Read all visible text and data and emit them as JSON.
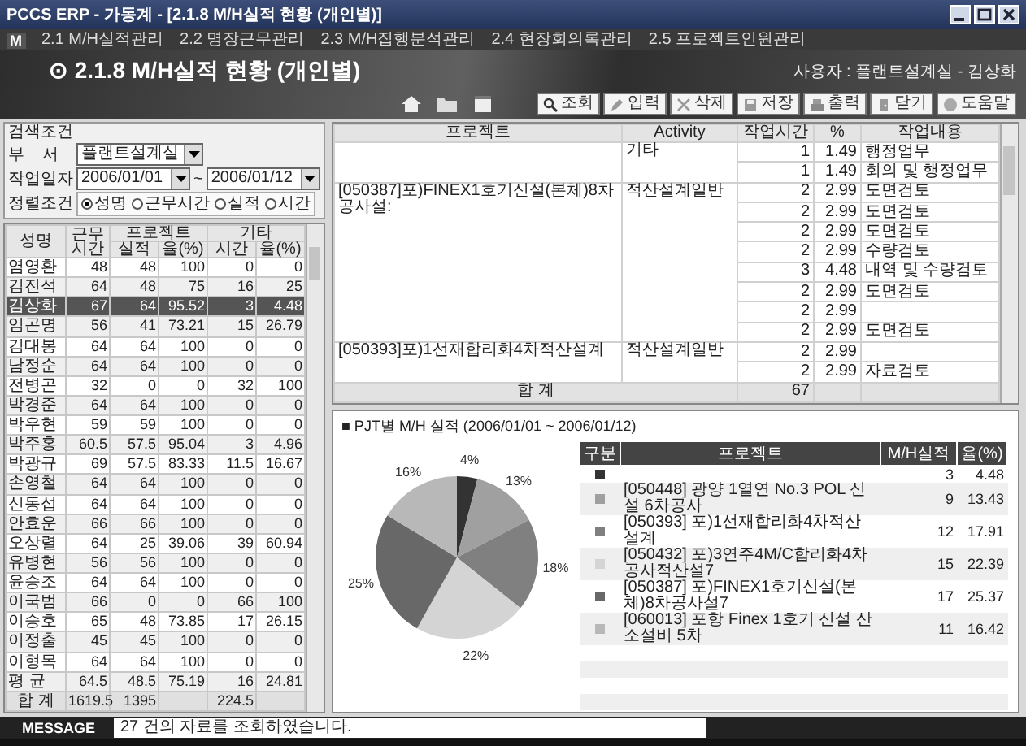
{
  "window": {
    "title": "PCCS ERP - 가동계 - [2.1.8 M/H실적 현황 (개인별)]"
  },
  "menu": {
    "logo": "M",
    "items": [
      "2.1 M/H실적관리",
      "2.2 명장근무관리",
      "2.3 M/H집행분석관리",
      "2.4 현장회의록관리",
      "2.5 프로젝트인원관리"
    ]
  },
  "header": {
    "title": "⊙ 2.1.8 M/H실적 현황 (개인별)",
    "user": "사용자 : 플랜트설계실 - 김상화"
  },
  "toolbar": [
    "조회",
    "입력",
    "삭제",
    "저장",
    "출력",
    "닫기",
    "도움말"
  ],
  "search": {
    "title": "검색조건",
    "dept_label": "부    서",
    "dept": "플랜트설계실",
    "date_label": "작업일자",
    "date_from": "2006/01/01",
    "tilde": "~",
    "date_to": "2006/01/12",
    "sort_label": "정렬조건",
    "sort_options": [
      {
        "label": "성명",
        "selected": true
      },
      {
        "label": "근무시간",
        "selected": false
      },
      {
        "label": "실적",
        "selected": false
      },
      {
        "label": "시간",
        "selected": false
      }
    ]
  },
  "grid": {
    "columns": {
      "name": "성명",
      "hours": "근무시간",
      "project": "프로젝트",
      "other": "기타",
      "actual": "실적",
      "ratio": "율(%)",
      "time": "시간",
      "ratio2": "율(%)"
    },
    "rows": [
      {
        "cells": [
          "염영환",
          "48",
          "48",
          "100",
          "0",
          "0"
        ],
        "selected": false
      },
      {
        "cells": [
          "김진석",
          "64",
          "48",
          "75",
          "16",
          "25"
        ],
        "selected": false
      },
      {
        "cells": [
          "김상화",
          "67",
          "64",
          "95.52",
          "3",
          "4.48"
        ],
        "selected": true
      },
      {
        "cells": [
          "임곤명",
          "56",
          "41",
          "73.21",
          "15",
          "26.79"
        ],
        "selected": false
      },
      {
        "cells": [
          "김대봉",
          "64",
          "64",
          "100",
          "0",
          "0"
        ],
        "selected": false
      },
      {
        "cells": [
          "남정순",
          "64",
          "64",
          "100",
          "0",
          "0"
        ],
        "selected": false
      },
      {
        "cells": [
          "전병곤",
          "32",
          "0",
          "0",
          "32",
          "100"
        ],
        "selected": false
      },
      {
        "cells": [
          "박경준",
          "64",
          "64",
          "100",
          "0",
          "0"
        ],
        "selected": false
      },
      {
        "cells": [
          "박우현",
          "59",
          "59",
          "100",
          "0",
          "0"
        ],
        "selected": false
      },
      {
        "cells": [
          "박주홍",
          "60.5",
          "57.5",
          "95.04",
          "3",
          "4.96"
        ],
        "selected": false
      },
      {
        "cells": [
          "박광규",
          "69",
          "57.5",
          "83.33",
          "11.5",
          "16.67"
        ],
        "selected": false
      },
      {
        "cells": [
          "손영철",
          "64",
          "64",
          "100",
          "0",
          "0"
        ],
        "selected": false
      },
      {
        "cells": [
          "신동섭",
          "64",
          "64",
          "100",
          "0",
          "0"
        ],
        "selected": false
      },
      {
        "cells": [
          "안효운",
          "66",
          "66",
          "100",
          "0",
          "0"
        ],
        "selected": false
      },
      {
        "cells": [
          "오상렬",
          "64",
          "25",
          "39.06",
          "39",
          "60.94"
        ],
        "selected": false
      },
      {
        "cells": [
          "유병현",
          "56",
          "56",
          "100",
          "0",
          "0"
        ],
        "selected": false
      },
      {
        "cells": [
          "윤승조",
          "64",
          "64",
          "100",
          "0",
          "0"
        ],
        "selected": false
      },
      {
        "cells": [
          "이국범",
          "66",
          "0",
          "0",
          "66",
          "100"
        ],
        "selected": false
      },
      {
        "cells": [
          "이승호",
          "65",
          "48",
          "73.85",
          "17",
          "26.15"
        ],
        "selected": false
      },
      {
        "cells": [
          "이정출",
          "45",
          "45",
          "100",
          "0",
          "0"
        ],
        "selected": false
      },
      {
        "cells": [
          "이형목",
          "64",
          "64",
          "100",
          "0",
          "0"
        ],
        "selected": false
      },
      {
        "cells": [
          "평 균",
          "64.5",
          "48.5",
          "75.19",
          "16",
          "24.81"
        ],
        "selected": false
      }
    ],
    "total": {
      "label": "합   계",
      "hours": "1619.5",
      "actual": "1395",
      "time": "224.5"
    }
  },
  "detail": {
    "columns": [
      "프로젝트",
      "Activity",
      "작업시간",
      "%",
      "작업내용"
    ],
    "groups": [
      {
        "activity": "기타",
        "entries": [
          {
            "hours": "1",
            "pct": "1.49",
            "task": "행정업무"
          },
          {
            "hours": "1",
            "pct": "1.49",
            "task": "회의 및 행정업무"
          }
        ]
      },
      {
        "project": "[050387]포)FINEX1호기신설(본체)8차공사설:",
        "activity": "적산설계일반",
        "entries": [
          {
            "hours": "2",
            "pct": "2.99",
            "task": "도면검토"
          },
          {
            "hours": "2",
            "pct": "2.99",
            "task": "도면검토"
          },
          {
            "hours": "2",
            "pct": "2.99",
            "task": "도면검토"
          },
          {
            "hours": "2",
            "pct": "2.99",
            "task": "수량검토"
          },
          {
            "hours": "3",
            "pct": "4.48",
            "task": "내역 및 수량검토"
          },
          {
            "hours": "2",
            "pct": "2.99",
            "task": "도면검토"
          },
          {
            "hours": "2",
            "pct": "2.99"
          },
          {
            "hours": "2",
            "pct": "2.99",
            "task": "도면검토"
          }
        ]
      },
      {
        "project": "[050393]포)1선재합리화4차적산설계",
        "activity": "적산설계일반",
        "entries": [
          {
            "hours": "2",
            "pct": "2.99"
          },
          {
            "hours": "2",
            "pct": "2.99",
            "task": "자료검토"
          }
        ]
      }
    ],
    "total": {
      "label": "합   계",
      "hours": "67"
    }
  },
  "chart_panel": {
    "title": "■ PJT별 M/H 실적 (2006/01/01 ~ 2006/01/12)",
    "chart_data": {
      "type": "pie",
      "categories": [
        null,
        "[050448] 광양 1열연 No.3 POL 신설 6차공사",
        "[050393] 포)1선재합리화4차적산설계",
        "[050432] 포)3연주4M/C합리화4차공사적산설7",
        "[050387] 포)FINEX1호기신설(본체)8차공사설7",
        "[060013] 포항 Finex 1호기 신설 산소설비 5차"
      ],
      "values": [
        4,
        13,
        18,
        22,
        25,
        16
      ],
      "value_labels": [
        "4%",
        "13%",
        "18%",
        "22%",
        "25%",
        "16%"
      ]
    },
    "legend_columns": [
      "구분",
      "프로젝트",
      "M/H실적",
      "율(%)"
    ],
    "legend": [
      {
        "color": "#333333",
        "mh": "3",
        "pct": "4.48"
      },
      {
        "color": "#a0a0a0",
        "mh": "9",
        "pct": "13.43"
      },
      {
        "color": "#808080",
        "mh": "12",
        "pct": "17.91"
      },
      {
        "color": "#d4d4d4",
        "mh": "15",
        "pct": "22.39"
      },
      {
        "color": "#686868",
        "mh": "17",
        "pct": "25.37"
      },
      {
        "color": "#b8b8b8",
        "mh": "11",
        "pct": "16.42"
      }
    ]
  },
  "message": {
    "label": "MESSAGE",
    "text": "27 건의 자료를 조회하였습니다."
  }
}
